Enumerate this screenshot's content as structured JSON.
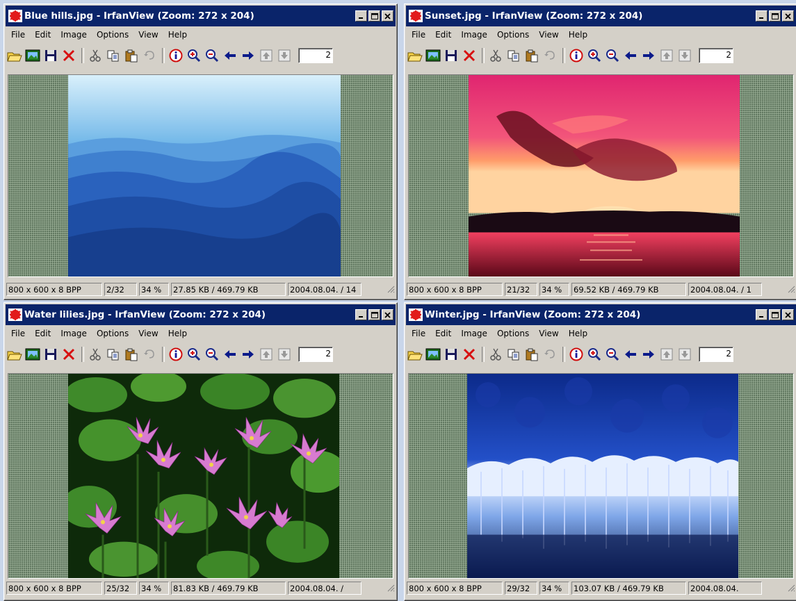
{
  "menu": [
    "File",
    "Edit",
    "Image",
    "Options",
    "View",
    "Help"
  ],
  "windows": [
    {
      "title": "Blue hills.jpg - IrfanView (Zoom: 272 x 204)",
      "page_field": "2",
      "status": {
        "resolution": "800 x 600 x 8 BPP",
        "index": "2/32",
        "zoom": "34 %",
        "size": "27.85 KB / 469.79 KB",
        "date": "2004.08.04. / 14"
      }
    },
    {
      "title": "Sunset.jpg - IrfanView (Zoom: 272 x 204)",
      "page_field": "2",
      "status": {
        "resolution": "800 x 600 x 8 BPP",
        "index": "21/32",
        "zoom": "34 %",
        "size": "69.52 KB / 469.79 KB",
        "date": "2004.08.04. / 1"
      }
    },
    {
      "title": "Water lilies.jpg - IrfanView (Zoom: 272 x 204)",
      "page_field": "2",
      "status": {
        "resolution": "800 x 600 x 8 BPP",
        "index": "25/32",
        "zoom": "34 %",
        "size": "81.83 KB / 469.79 KB",
        "date": "2004.08.04. /"
      }
    },
    {
      "title": "Winter.jpg - IrfanView (Zoom: 272 x 204)",
      "page_field": "2",
      "status": {
        "resolution": "800 x 600 x 8 BPP",
        "index": "29/32",
        "zoom": "34 %",
        "size": "103.07 KB / 469.79 KB",
        "date": "2004.08.04."
      }
    }
  ],
  "toolbar_icons": [
    "open-folder-icon",
    "slideshow-icon",
    "save-disk-icon",
    "delete-x-icon",
    "cut-scissors-icon",
    "copy-icon",
    "paste-icon",
    "undo-icon",
    "info-icon",
    "zoom-in-icon",
    "zoom-out-icon",
    "previous-arrow-icon",
    "next-arrow-icon",
    "first-file-icon",
    "last-file-icon"
  ],
  "colors": {
    "titlebar": "#0a246a",
    "window_face": "#d4d0c8",
    "viewport_bg": "#617860"
  }
}
